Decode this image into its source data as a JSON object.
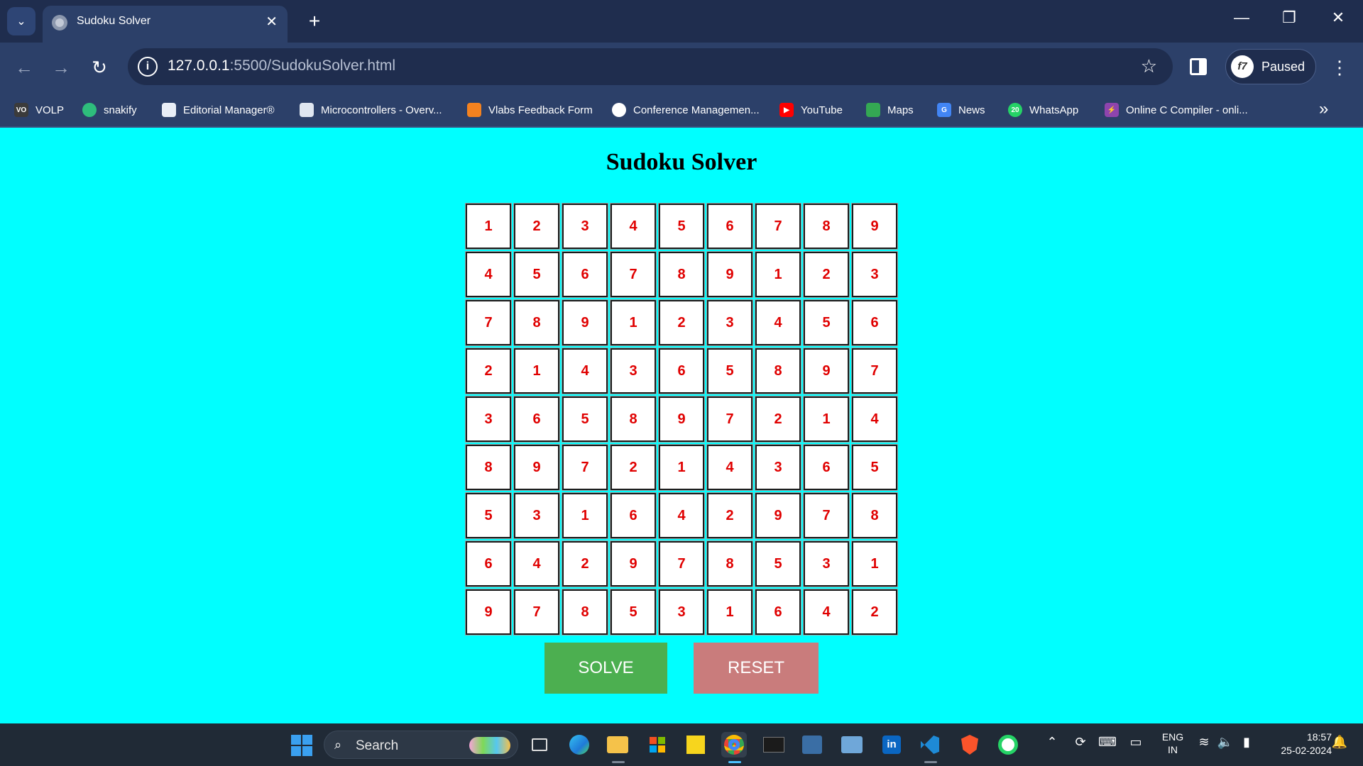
{
  "browser": {
    "tab_title": "Sudoku Solver",
    "url_host": "127.0.0.1",
    "url_rest": ":5500/SudokuSolver.html",
    "profile_label": "Paused",
    "profile_avatar": "f7"
  },
  "bookmarks": [
    {
      "label": "VOLP",
      "icon": "volp-icon",
      "color": "#3b3b3b",
      "glyph": "VO"
    },
    {
      "label": "snakify",
      "icon": "snake-icon",
      "color": "#2ebd7c",
      "glyph": ""
    },
    {
      "label": "Editorial Manager®",
      "icon": "chart-icon",
      "color": "#ffffff",
      "glyph": ""
    },
    {
      "label": "Microcontrollers - Overv...",
      "icon": "chip-icon",
      "color": "#ffffff",
      "glyph": ""
    },
    {
      "label": "Vlabs Feedback Form",
      "icon": "form-icon",
      "color": "#f4821f",
      "glyph": ""
    },
    {
      "label": "Conference Managemen...",
      "icon": "globe-icon",
      "color": "#ffffff",
      "glyph": ""
    },
    {
      "label": "YouTube",
      "icon": "youtube-icon",
      "color": "#ff0000",
      "glyph": "▶"
    },
    {
      "label": "Maps",
      "icon": "maps-icon",
      "color": "#34a853",
      "glyph": ""
    },
    {
      "label": "News",
      "icon": "news-icon",
      "color": "#4285f4",
      "glyph": "G"
    },
    {
      "label": "WhatsApp",
      "icon": "whatsapp-icon",
      "color": "#25d366",
      "glyph": "20"
    },
    {
      "label": "Online C Compiler - onli...",
      "icon": "bolt-icon",
      "color": "#8e44ad",
      "glyph": "⚡"
    }
  ],
  "page": {
    "title": "Sudoku Solver",
    "grid": [
      [
        "1",
        "2",
        "3",
        "4",
        "5",
        "6",
        "7",
        "8",
        "9"
      ],
      [
        "4",
        "5",
        "6",
        "7",
        "8",
        "9",
        "1",
        "2",
        "3"
      ],
      [
        "7",
        "8",
        "9",
        "1",
        "2",
        "3",
        "4",
        "5",
        "6"
      ],
      [
        "2",
        "1",
        "4",
        "3",
        "6",
        "5",
        "8",
        "9",
        "7"
      ],
      [
        "3",
        "6",
        "5",
        "8",
        "9",
        "7",
        "2",
        "1",
        "4"
      ],
      [
        "8",
        "9",
        "7",
        "2",
        "1",
        "4",
        "3",
        "6",
        "5"
      ],
      [
        "5",
        "3",
        "1",
        "6",
        "4",
        "2",
        "9",
        "7",
        "8"
      ],
      [
        "6",
        "4",
        "2",
        "9",
        "7",
        "8",
        "5",
        "3",
        "1"
      ],
      [
        "9",
        "7",
        "8",
        "5",
        "3",
        "1",
        "6",
        "4",
        "2"
      ]
    ],
    "solve_label": "SOLVE",
    "reset_label": "RESET"
  },
  "taskbar": {
    "search_label": "Search",
    "lang_line1": "ENG",
    "lang_line2": "IN",
    "time": "18:57",
    "date": "25-02-2024",
    "apps": [
      "task-view-icon",
      "edge-icon",
      "file-explorer-icon",
      "store-icon",
      "sticky-notes-icon",
      "chrome-icon",
      "terminal-icon",
      "mysql-icon",
      "remote-desktop-icon",
      "linkedin-icon",
      "vscode-icon",
      "brave-icon",
      "whatsapp-icon"
    ]
  }
}
